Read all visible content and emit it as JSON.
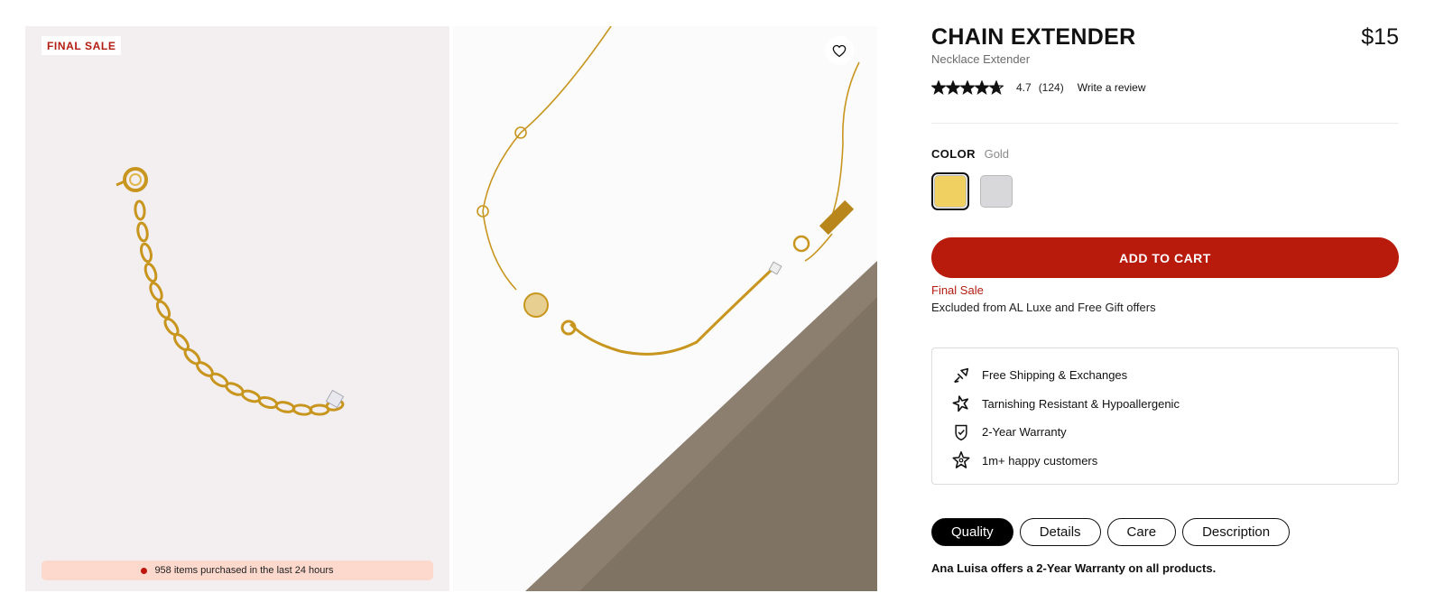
{
  "gallery": {
    "badge": "FINAL SALE",
    "purchased_text": "958 items purchased in the last 24 hours"
  },
  "product": {
    "title": "CHAIN EXTENDER",
    "price": "$15",
    "subtitle": "Necklace Extender",
    "rating": {
      "value": "4.7",
      "count": "(124)",
      "stars": 4.7,
      "write_review": "Write a review"
    }
  },
  "color": {
    "label": "COLOR",
    "selected": "Gold",
    "swatches": [
      {
        "name": "Gold",
        "hex": "#efd060",
        "selected": true
      },
      {
        "name": "Silver",
        "hex": "#d8d8da",
        "selected": false
      }
    ]
  },
  "cart": {
    "button": "ADD TO CART"
  },
  "notes": {
    "final_sale": "Final Sale",
    "excluded": "Excluded from AL Luxe and Free Gift offers"
  },
  "features": [
    {
      "icon": "shipping-icon",
      "text": "Free Shipping & Exchanges"
    },
    {
      "icon": "sparkle-icon",
      "text": "Tarnishing Resistant & Hypoallergenic"
    },
    {
      "icon": "shield-check-icon",
      "text": "2-Year Warranty"
    },
    {
      "icon": "star-outline-icon",
      "text": "1m+ happy customers"
    }
  ],
  "tabs": [
    {
      "label": "Quality",
      "active": true
    },
    {
      "label": "Details",
      "active": false
    },
    {
      "label": "Care",
      "active": false
    },
    {
      "label": "Description",
      "active": false
    }
  ],
  "tab_content": "Ana Luisa offers a 2-Year Warranty on all products.",
  "colors": {
    "accent": "#b81b0c",
    "sale_text": "#b31c10",
    "purchased_bg": "#fcd9cc"
  }
}
